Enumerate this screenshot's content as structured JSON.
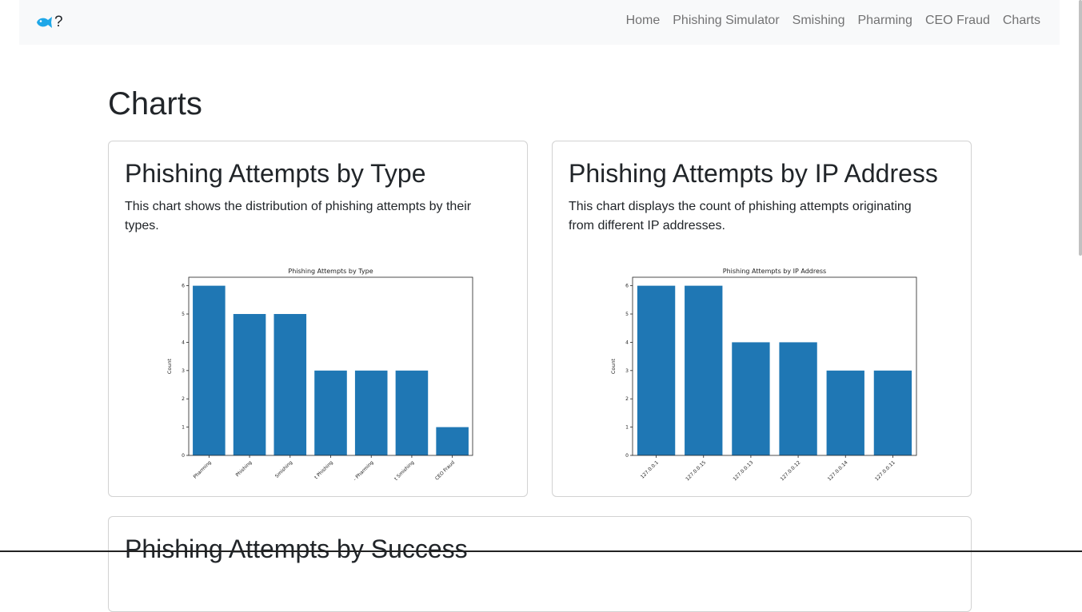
{
  "navbar": {
    "brand_text": "?",
    "brand_icon": "fish-icon",
    "brand_color": "#1ea7e8",
    "links": [
      "Home",
      "Phishing Simulator",
      "Smishing",
      "Pharming",
      "CEO Fraud",
      "Charts"
    ]
  },
  "page": {
    "title": "Charts"
  },
  "cards": [
    {
      "title": "Phishing Attempts by Type",
      "description": "This chart shows the distribution of phishing attempts by their types."
    },
    {
      "title": "Phishing Attempts by IP Address",
      "description": "This chart displays the count of phishing attempts originating from different IP addresses."
    },
    {
      "title": "Phishing Attempts by Success",
      "description": ""
    }
  ],
  "chart_data": [
    {
      "type": "bar",
      "title": "Phishing Attempts by Type",
      "xlabel": "",
      "ylabel": "Count",
      "categories": [
        "Pharming",
        "Phishing",
        "Smishing",
        "t Phishing",
        "- Pharming",
        "t Smishing",
        "CEO Fraud"
      ],
      "values": [
        6,
        5,
        5,
        3,
        3,
        3,
        1
      ],
      "ylim": [
        0,
        6.3
      ],
      "yticks": [
        0,
        1,
        2,
        3,
        4,
        5,
        6
      ],
      "color": "#1f77b4",
      "grid": false
    },
    {
      "type": "bar",
      "title": "Phishing Attempts by IP Address",
      "xlabel": "",
      "ylabel": "Count",
      "categories": [
        "127.0.0.1",
        "127.0.0.15",
        "127.0.0.13",
        "127.0.0.12",
        "127.0.0.14",
        "127.0.0.11"
      ],
      "values": [
        6,
        6,
        4,
        4,
        3,
        3
      ],
      "ylim": [
        0,
        6.3
      ],
      "yticks": [
        0,
        1,
        2,
        3,
        4,
        5,
        6
      ],
      "color": "#1f77b4",
      "grid": false
    }
  ]
}
